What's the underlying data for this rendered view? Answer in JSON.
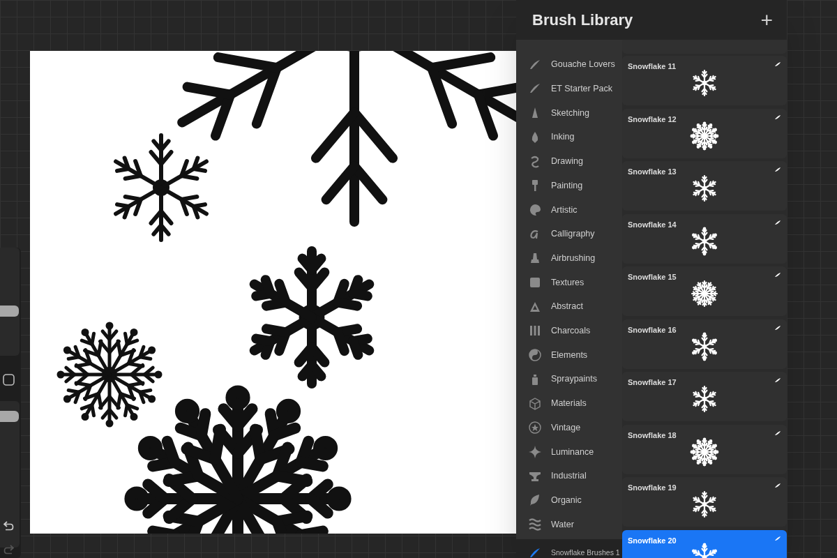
{
  "sidebar": {
    "sliders": [
      {
        "level": 0.4
      },
      {
        "level": 0.93
      }
    ]
  },
  "brush_library": {
    "title": "Brush Library",
    "add_button": "+",
    "categories": [
      {
        "label": "Gouache Lovers",
        "selected": false
      },
      {
        "label": "ET Starter Pack",
        "selected": false
      },
      {
        "label": "Sketching",
        "selected": false
      },
      {
        "label": "Inking",
        "selected": false
      },
      {
        "label": "Drawing",
        "selected": false
      },
      {
        "label": "Painting",
        "selected": false
      },
      {
        "label": "Artistic",
        "selected": false
      },
      {
        "label": "Calligraphy",
        "selected": false
      },
      {
        "label": "Airbrushing",
        "selected": false
      },
      {
        "label": "Textures",
        "selected": false
      },
      {
        "label": "Abstract",
        "selected": false
      },
      {
        "label": "Charcoals",
        "selected": false
      },
      {
        "label": "Elements",
        "selected": false
      },
      {
        "label": "Spraypaints",
        "selected": false
      },
      {
        "label": "Materials",
        "selected": false
      },
      {
        "label": "Vintage",
        "selected": false
      },
      {
        "label": "Luminance",
        "selected": false
      },
      {
        "label": "Industrial",
        "selected": false
      },
      {
        "label": "Organic",
        "selected": false
      },
      {
        "label": "Water",
        "selected": false
      },
      {
        "label": "Snowflake Brushes 1",
        "selected": true
      }
    ],
    "brushes": [
      {
        "name": "Snowflake 11",
        "selected": false
      },
      {
        "name": "Snowflake 12",
        "selected": false
      },
      {
        "name": "Snowflake 13",
        "selected": false
      },
      {
        "name": "Snowflake 14",
        "selected": false
      },
      {
        "name": "Snowflake 15",
        "selected": false
      },
      {
        "name": "Snowflake 16",
        "selected": false
      },
      {
        "name": "Snowflake 17",
        "selected": false
      },
      {
        "name": "Snowflake 18",
        "selected": false
      },
      {
        "name": "Snowflake 19",
        "selected": false
      },
      {
        "name": "Snowflake 20",
        "selected": true
      }
    ]
  }
}
